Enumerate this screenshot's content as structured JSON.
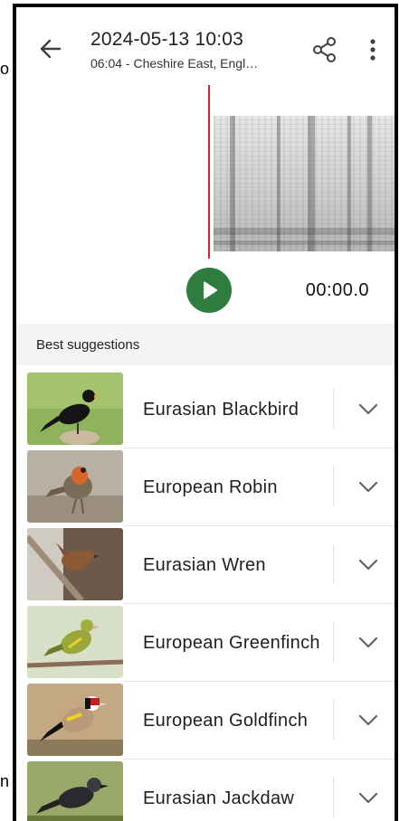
{
  "edge": {
    "left_top": "o",
    "left_bottom": "n"
  },
  "header": {
    "title": "2024-05-13 10:03",
    "subtitle": "06:04 - Cheshire East, Engl…"
  },
  "player": {
    "time": "00:00.0",
    "play_state": "paused",
    "accent_color": "#2e7d3e",
    "playhead_color": "#dd2222"
  },
  "suggestions": {
    "header": "Best suggestions",
    "items": [
      {
        "name": "Eurasian Blackbird"
      },
      {
        "name": "European Robin"
      },
      {
        "name": "Eurasian Wren"
      },
      {
        "name": "European Greenfinch"
      },
      {
        "name": "European Goldfinch"
      },
      {
        "name": "Eurasian Jackdaw"
      }
    ]
  },
  "icons": {
    "back": "arrow-left-icon",
    "share": "share-icon",
    "more": "more-vert-icon",
    "play": "play-icon",
    "expand": "chevron-down-icon"
  }
}
